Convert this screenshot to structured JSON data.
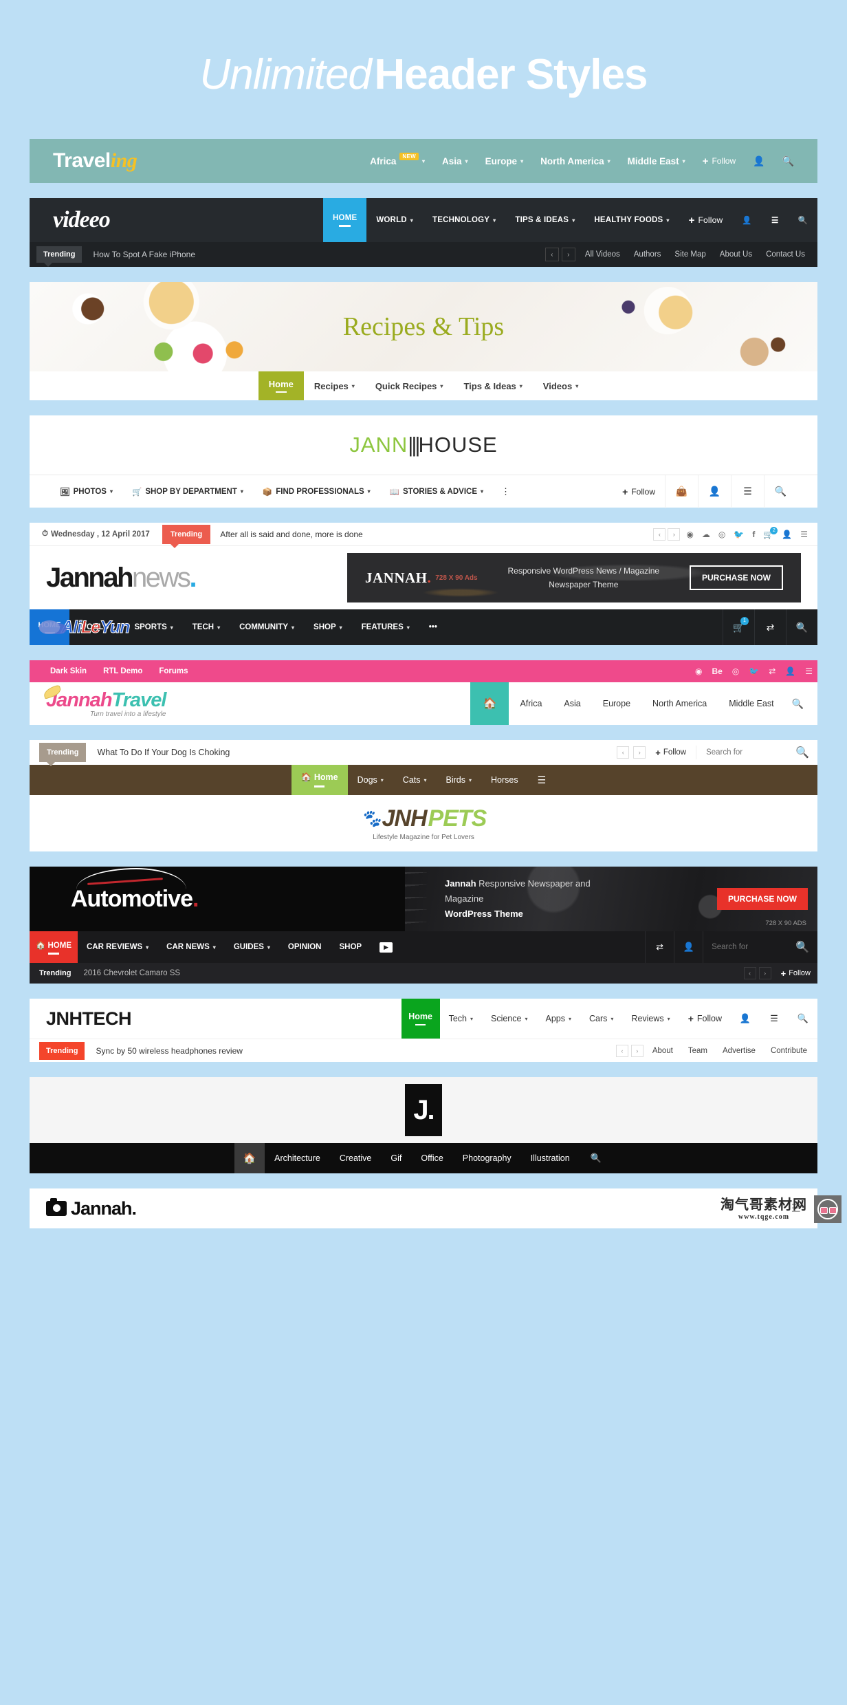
{
  "page": {
    "title_light": "Unlimited",
    "title_bold": "Header Styles",
    "bg_color": "#bddff5"
  },
  "traveling": {
    "logo_main": "Travel",
    "logo_accent": "ing",
    "nav": [
      {
        "label": "Africa",
        "badge": "NEW",
        "caret": "▾"
      },
      {
        "label": "Asia",
        "caret": "▾"
      },
      {
        "label": "Europe",
        "caret": "▾"
      },
      {
        "label": "North America",
        "caret": "▾"
      },
      {
        "label": "Middle East",
        "caret": "▾"
      }
    ],
    "follow": "Follow",
    "plus": "+",
    "user_icon": "user-icon",
    "search_icon": "search-icon",
    "accent": "#82b7b3",
    "badge_color": "#f5c125"
  },
  "videeo": {
    "logo": "videeo",
    "nav": [
      {
        "label": "HOME",
        "active": true
      },
      {
        "label": "WORLD",
        "caret": "▾"
      },
      {
        "label": "TECHNOLOGY",
        "caret": "▾"
      },
      {
        "label": "TIPS & IDEAS",
        "caret": "▾"
      },
      {
        "label": "HEALTHY FOODS",
        "caret": "▾"
      }
    ],
    "follow": "Follow",
    "plus": "+",
    "trending_label": "Trending",
    "trending_text": "How To Spot A Fake iPhone",
    "prev": "‹",
    "next": "›",
    "sub_links": [
      "All Videos",
      "Authors",
      "Site Map",
      "About Us",
      "Contact Us"
    ],
    "accent": "#29abe2"
  },
  "recipes": {
    "hero_title": "Recipes & Tips",
    "nav": [
      {
        "label": "Home",
        "active": true
      },
      {
        "label": "Recipes",
        "caret": "▾"
      },
      {
        "label": "Quick Recipes",
        "caret": "▾"
      },
      {
        "label": "Tips & Ideas",
        "caret": "▾"
      },
      {
        "label": "Videos",
        "caret": "▾"
      }
    ],
    "accent": "#a3b327"
  },
  "jannah_house": {
    "logo_green": "JANN",
    "logo_bars": "|||",
    "logo_dark": "HOUSE",
    "nav": [
      {
        "icon": "photo-icon",
        "label": "PHOTOS",
        "caret": "▾"
      },
      {
        "icon": "cart-icon",
        "label": "SHOP BY DEPARTMENT",
        "caret": "▾"
      },
      {
        "icon": "box-icon",
        "label": "FIND PROFESSIONALS",
        "caret": "▾"
      },
      {
        "icon": "book-icon",
        "label": "STORIES & ADVICE",
        "caret": "▾"
      }
    ],
    "dots": "⋮",
    "follow": "Follow",
    "plus": "+",
    "icons": [
      "bag-icon",
      "user-icon",
      "menu-icon",
      "search-icon"
    ],
    "accent": "#8dc63f"
  },
  "jannah_news": {
    "date": "Wednesday , 12 April 2017",
    "clock_icon": "clock-icon",
    "trending_label": "Trending",
    "trending_text": "After all is said and done, more is done",
    "prev": "‹",
    "next": "›",
    "social": [
      "instagram-icon",
      "soundcloud-icon",
      "dribbble-icon",
      "twitter-icon",
      "facebook-icon",
      "cart-icon",
      "user-icon",
      "menu-icon"
    ],
    "cart_count": "2",
    "logo_main": "Jannah",
    "logo_sub": "news",
    "logo_dot": ".",
    "ad": {
      "brand": "JANNAH",
      "brand_dot": ".",
      "size_label": "728 X 90 Ads",
      "line1": "Responsive WordPress News / Magazine",
      "line2": "Newspaper Theme",
      "button": "PURCHASE NOW"
    },
    "nav_home": "HOME",
    "nav": [
      {
        "label": "WORLD",
        "caret": "▾"
      },
      {
        "label": "SPORTS",
        "caret": "▾"
      },
      {
        "label": "TECH",
        "caret": "▾"
      },
      {
        "label": "COMMUNITY",
        "caret": "▾"
      },
      {
        "label": "SHOP",
        "caret": "▾"
      },
      {
        "label": "FEATURES",
        "caret": "▾"
      }
    ],
    "more": "•••",
    "nav_icons": [
      "cart-icon",
      "random-icon",
      "search-icon"
    ],
    "nav_cart_count": "1",
    "watermark": {
      "text1": "Ali",
      "text2": "Le",
      "text3": "Yun"
    },
    "accent": "#1574d6"
  },
  "jannah_travel": {
    "top_links": [
      "Dark Skin",
      "RTL Demo",
      "Forums"
    ],
    "social": [
      "instagram-icon",
      "behance-icon",
      "dribbble-icon",
      "twitter-icon",
      "random-icon",
      "user-icon",
      "menu-icon"
    ],
    "logo_j": "Jannah",
    "logo_t": "Travel",
    "tagline": "Turn travel into a lifestyle",
    "home_icon": "home-icon",
    "nav": [
      "Africa",
      "Asia",
      "Europe",
      "North America",
      "Middle East"
    ],
    "search_icon": "search-icon",
    "accent_pink": "#ef4a8b",
    "accent_teal": "#3cc0b0"
  },
  "jnh_pets": {
    "trending_label": "Trending",
    "trending_text": "What To Do If Your Dog Is Choking",
    "prev": "‹",
    "next": "›",
    "follow": "Follow",
    "plus": "+",
    "search_placeholder": "Search for",
    "search_icon": "search-icon",
    "nav": [
      {
        "label": "Home",
        "icon": "home-icon",
        "active": true
      },
      {
        "label": "Dogs",
        "caret": "▾"
      },
      {
        "label": "Cats",
        "caret": "▾"
      },
      {
        "label": "Birds",
        "caret": "▾"
      },
      {
        "label": "Horses"
      }
    ],
    "burger": "menu-icon",
    "logo_paw": "paw-icon",
    "logo_jnh": "JNH",
    "logo_pets": "PETS",
    "logo_sub": "Lifestyle Magazine for Pet Lovers",
    "accent_brown": "#56432b",
    "accent_green": "#9ccb55"
  },
  "automotive": {
    "logo": "Automotive",
    "logo_dot": ".",
    "ad": {
      "bold": "Jannah",
      "rest": " Responsive Newspaper and Magazine",
      "line2": "WordPress Theme",
      "button": "PURCHASE NOW",
      "size_label": "728 X 90 ADS"
    },
    "nav_home": "HOME",
    "home_icon": "home-icon",
    "nav": [
      {
        "label": "CAR REVIEWS",
        "caret": "▾"
      },
      {
        "label": "CAR NEWS",
        "caret": "▾"
      },
      {
        "label": "GUIDES",
        "caret": "▾"
      },
      {
        "label": "OPINION"
      },
      {
        "label": "SHOP"
      }
    ],
    "youtube_icon": "youtube-icon",
    "icons": [
      "random-icon",
      "user-icon"
    ],
    "search_placeholder": "Search for",
    "search_icon": "search-icon",
    "trending_label": "Trending",
    "trending_text": "2016 Chevrolet Camaro SS",
    "prev": "‹",
    "next": "›",
    "follow": "Follow",
    "plus": "+",
    "accent": "#e8322a"
  },
  "jnhtech": {
    "logo": "JNHTECH",
    "nav_home": "Home",
    "nav": [
      {
        "label": "Tech",
        "caret": "▾"
      },
      {
        "label": "Science",
        "caret": "▾"
      },
      {
        "label": "Apps",
        "caret": "▾"
      },
      {
        "label": "Cars",
        "caret": "▾"
      },
      {
        "label": "Reviews",
        "caret": "▾"
      }
    ],
    "follow": "Follow",
    "plus": "+",
    "icons": [
      "user-icon",
      "menu-icon",
      "search-icon"
    ],
    "trending_label": "Trending",
    "trending_text": "Sync by 50 wireless headphones review",
    "prev": "‹",
    "next": "›",
    "links": [
      "About",
      "Team",
      "Advertise",
      "Contribute"
    ],
    "accent": "#0aa51e",
    "trending_color": "#f4452b"
  },
  "jblock": {
    "logo": "J.",
    "home_icon": "home-icon",
    "nav": [
      "Architecture",
      "Creative",
      "Gif",
      "Office",
      "Photography",
      "Illustration"
    ],
    "search_icon": "search-icon"
  },
  "camera_block": {
    "camera_icon": "camera-icon",
    "logo": "Jannah.",
    "burger": "menu-icon"
  },
  "watermark": {
    "cn_text": "淘气哥素材网",
    "url": "www.tqge.com",
    "face_icon": "glasses-face-icon"
  }
}
